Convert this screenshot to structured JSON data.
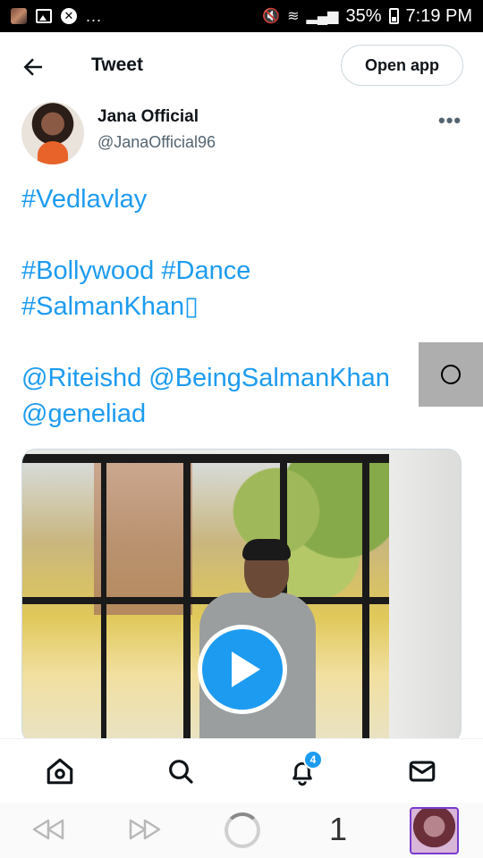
{
  "status_bar": {
    "battery": "35%",
    "time": "7:19 PM",
    "more": "..."
  },
  "header": {
    "title": "Tweet",
    "open_app_label": "Open app"
  },
  "author": {
    "name": "Jana Official",
    "handle": "@JanaOfficial96",
    "more": "•••"
  },
  "tweet": {
    "lines": [
      "#Vedlavlay",
      "",
      "#Bollywood #Dance",
      "#SalmanKhan▯",
      "",
      "@Riteishd @BeingSalmanKhan",
      "@geneliad"
    ]
  },
  "bottom_nav": {
    "notifications_badge": "4"
  },
  "browser_bar": {
    "tab_count": "1"
  },
  "colors": {
    "accent": "#1d9bf0",
    "text": "#0f1419",
    "muted": "#536471"
  }
}
